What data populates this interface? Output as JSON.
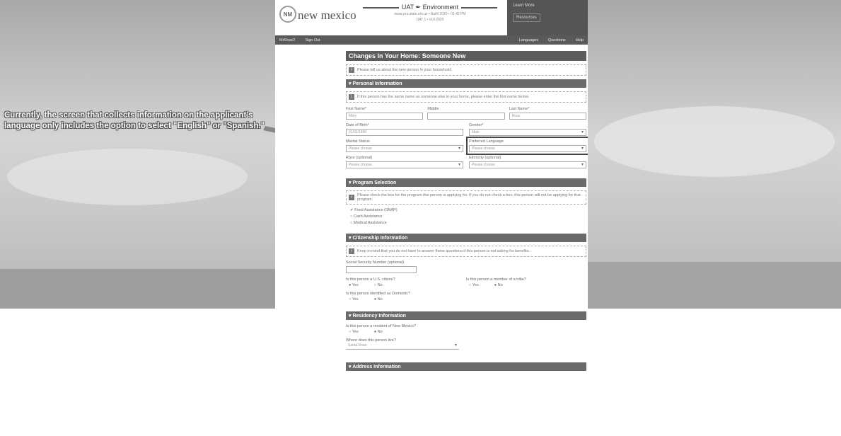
{
  "annotation": {
    "text": "Currently, the screen that collects information on the applicant's language only includes the option to select \"English\" or \"Spanish.\""
  },
  "header": {
    "logo_text": "NM",
    "brand": "new mexico",
    "env_title": "UAT ✒ Environment",
    "env_line1": "www.yes.state.nm.us • Build 2020 • 01:42 PM",
    "env_line2": "UAT 1 • v10.2020",
    "learn_more": "Learn More",
    "resources": "Resources"
  },
  "nav": {
    "account": "MrRose2",
    "sign_out": "Sign Out",
    "languages": "Languages",
    "questions": "Questions",
    "help": "Help"
  },
  "page": {
    "title": "Changes In Your Home: Someone New",
    "intro_note": "Please tell us about the new person in your household."
  },
  "personal": {
    "heading": "▾ Personal Information",
    "note": "If this person has the same name as someone else in your home, please enter the first name below.",
    "first_name_label": "First Name*",
    "first_name_value": "Mary",
    "middle_label": "Middle",
    "last_name_label": "Last Name*",
    "last_name_value": "Rose",
    "dob_label": "Date of Birth*",
    "dob_value": "01/01/1990",
    "gender_label": "Gender*",
    "gender_value": "Male",
    "marital_label": "Marital Status",
    "marital_value": "Please choose",
    "language_label": "Preferred Language",
    "language_value": "Please choose",
    "race_label": "Race (optional)",
    "race_value": "Please choose",
    "ethnicity_label": "Ethnicity (optional)",
    "ethnicity_value": "Please choose"
  },
  "program": {
    "heading": "▾ Program Selection",
    "note": "Please check the box for the program this person is applying for. If you do not check a box, this person will not be applying for that program.",
    "options": [
      "Food Assistance (SNAP)",
      "Cash Assistance",
      "Medical Assistance"
    ]
  },
  "citizenship": {
    "heading": "▾ Citizenship Information",
    "note": "Keep in mind that you do not have to answer these questions if this person is not asking for benefits.",
    "ssn_label": "Social Security Number (optional)",
    "q_citizen": "Is this person a U.S. citizen?",
    "q_member": "Is this person a member of a tribe?",
    "q_domestic": "Is this person identified as Domestic?",
    "yes": "Yes",
    "no": "No"
  },
  "residency": {
    "heading": "▾ Residency Information",
    "q_resident": "Is this person a resident of New Mexico?",
    "q_county": "Where does this person live?",
    "county_value": "Santa Rosa"
  },
  "next_section": {
    "heading": "▾ Address Information"
  },
  "colors": {
    "bar": "#5d5d5d",
    "sky": "#bdbdbd"
  }
}
